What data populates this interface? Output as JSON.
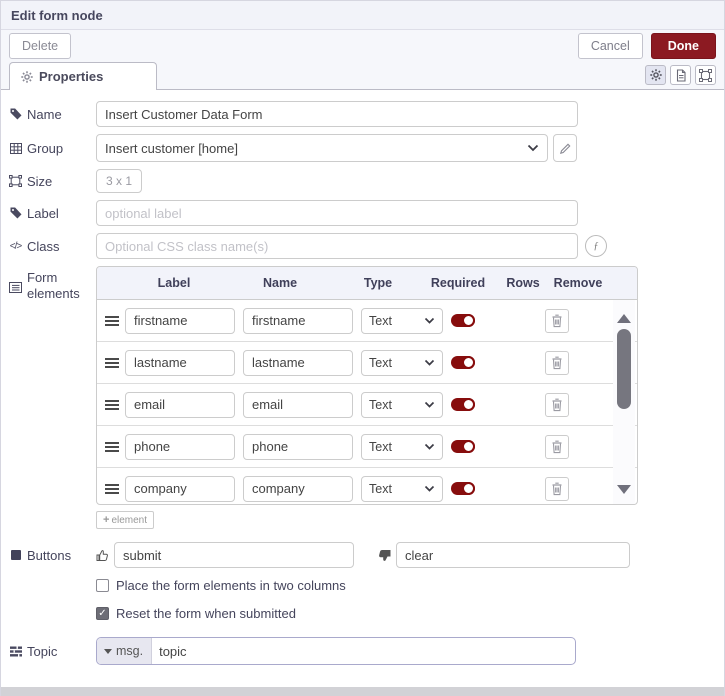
{
  "dialog": {
    "title": "Edit form node"
  },
  "toolbar": {
    "delete_label": "Delete",
    "cancel_label": "Cancel",
    "done_label": "Done"
  },
  "tabs": {
    "properties_label": "Properties"
  },
  "fields": {
    "name": {
      "label": "Name",
      "value": "Insert Customer Data Form"
    },
    "group": {
      "label": "Group",
      "value": "Insert customer [home]"
    },
    "size": {
      "label": "Size",
      "value": "3 x 1"
    },
    "label_field": {
      "label": "Label",
      "value": "",
      "placeholder": "optional label"
    },
    "class_field": {
      "label": "Class",
      "value": "",
      "placeholder": "Optional CSS class name(s)"
    },
    "form_elements": {
      "label_line1": "Form",
      "label_line2": "elements"
    },
    "buttons": {
      "label": "Buttons",
      "submit_value": "submit",
      "clear_value": "clear"
    },
    "topic": {
      "label": "Topic",
      "prefix": "msg.",
      "value": "topic"
    }
  },
  "elements_table": {
    "headers": [
      "Label",
      "Name",
      "Type",
      "Required",
      "Rows",
      "Remove"
    ],
    "rows": [
      {
        "label": "firstname",
        "name": "firstname",
        "type": "Text",
        "required": true
      },
      {
        "label": "lastname",
        "name": "lastname",
        "type": "Text",
        "required": true
      },
      {
        "label": "email",
        "name": "email",
        "type": "Text",
        "required": true
      },
      {
        "label": "phone",
        "name": "phone",
        "type": "Text",
        "required": true
      },
      {
        "label": "company",
        "name": "company",
        "type": "Text",
        "required": true
      }
    ],
    "add_button_label": "element"
  },
  "checkboxes": [
    {
      "label": "Place the form elements in two columns",
      "checked": false
    },
    {
      "label": "Reset the form when submitted",
      "checked": true
    }
  ],
  "colors": {
    "done_button": "#8C1A22",
    "toggle_on": "#870d0d",
    "header_bg": "#f2f3f9",
    "table_header_bg": "#f2f3fa"
  }
}
